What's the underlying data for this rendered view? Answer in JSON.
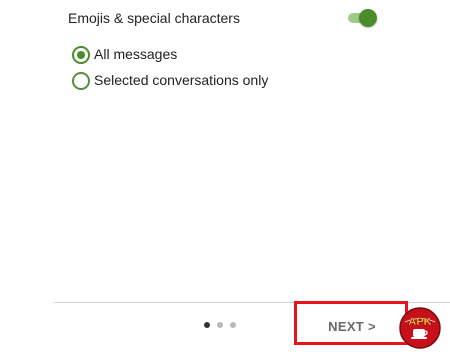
{
  "settings": {
    "emoji_label": "Emojis & special characters",
    "emoji_toggle_on": true
  },
  "options": [
    {
      "label": "All messages",
      "selected": true
    },
    {
      "label": "Selected conversations only",
      "selected": false
    }
  ],
  "pager": {
    "total_pages": 3,
    "current_page": 1
  },
  "footer": {
    "next_label": "NEXT >"
  },
  "watermark": {
    "text": "APK"
  },
  "colors": {
    "accent": "#4a8c2a",
    "highlight_border": "#e8141c",
    "watermark_red": "#c8101a"
  }
}
